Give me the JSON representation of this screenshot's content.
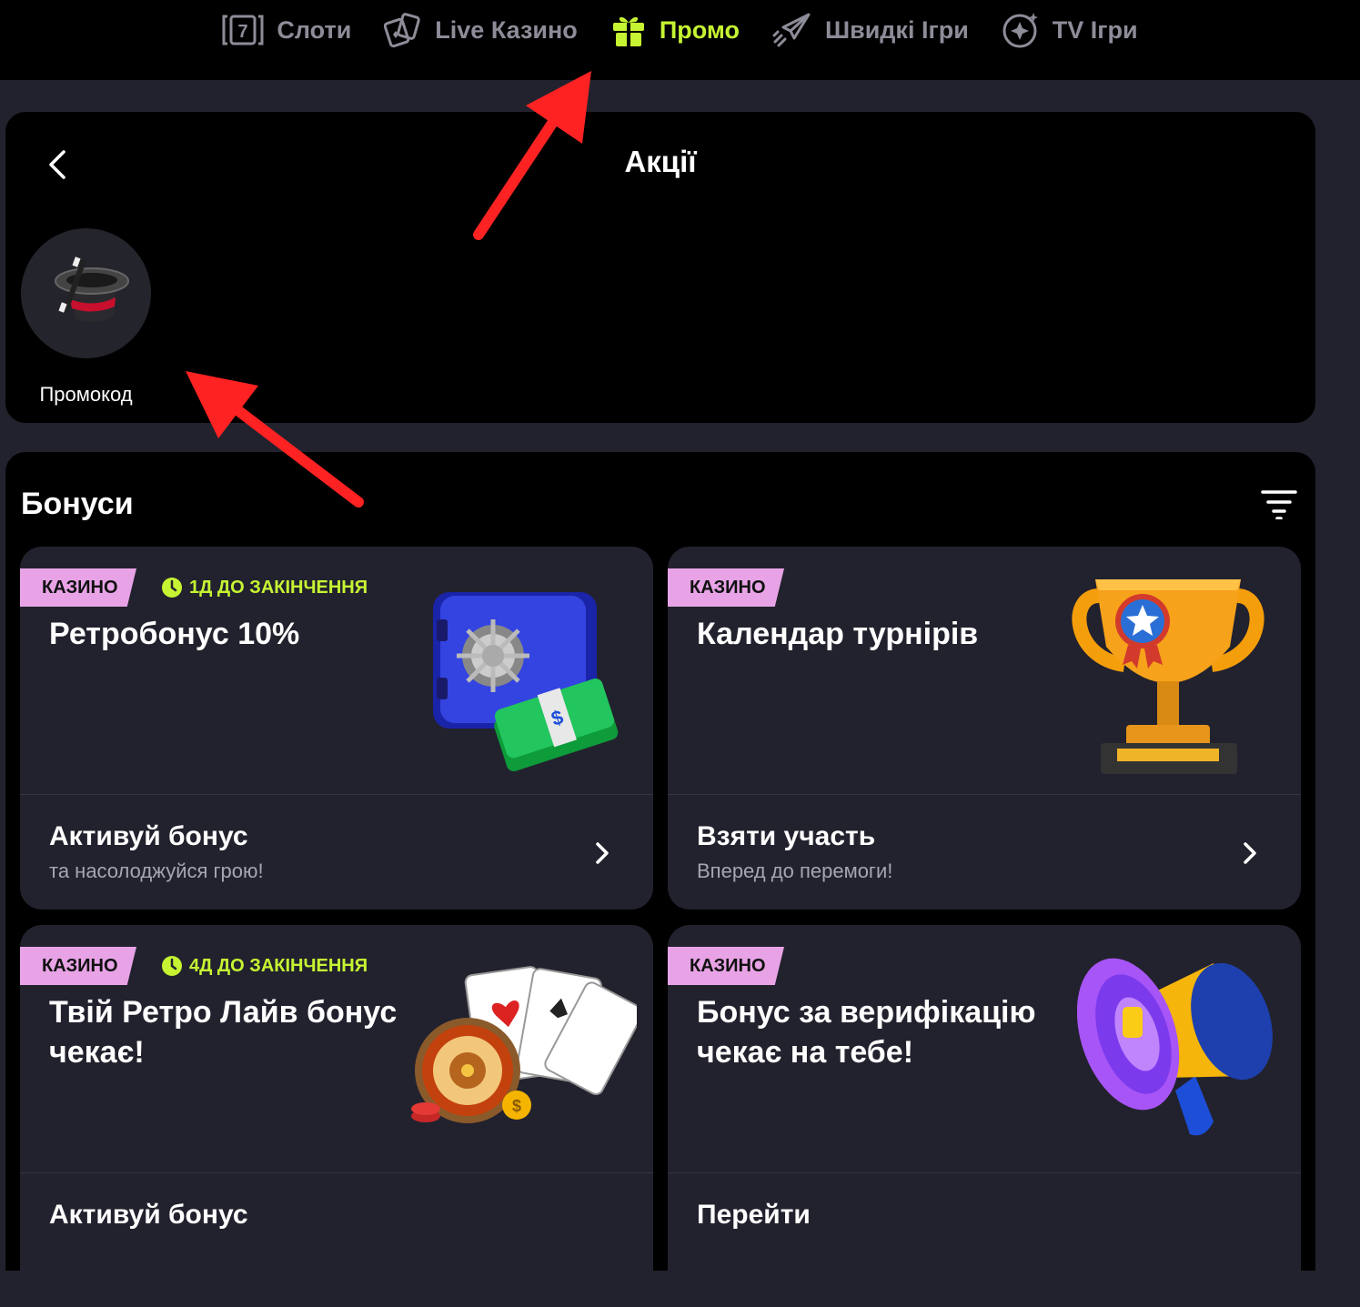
{
  "nav": {
    "items": [
      {
        "label": "Слоти",
        "icon": "slot-7-icon",
        "active": false
      },
      {
        "label": "Live Казино",
        "icon": "cards-icon",
        "active": false
      },
      {
        "label": "Промо",
        "icon": "gift-icon",
        "active": true
      },
      {
        "label": "Швидкі Ігри",
        "icon": "rocket-icon",
        "active": false
      },
      {
        "label": "TV Ігри",
        "icon": "tv-star-icon",
        "active": false
      }
    ],
    "active_color": "#c6f432"
  },
  "promotions": {
    "title": "Акції",
    "promo_code": {
      "label": "Промокод",
      "icon": "magic-hat-icon"
    }
  },
  "bonuses": {
    "title": "Бонуси",
    "cards": [
      {
        "tag": "КАЗИНО",
        "timer": "1Д ДО ЗАКІНЧЕННЯ",
        "title": "Ретробонус 10%",
        "action": "Активуй бонус",
        "subtitle": "та насолоджуйся грою!",
        "art": "safe-money-icon"
      },
      {
        "tag": "КАЗИНО",
        "timer": "",
        "title": "Календар турнірів",
        "action": "Взяти участь",
        "subtitle": "Вперед до перемоги!",
        "art": "trophy-icon"
      },
      {
        "tag": "КАЗИНО",
        "timer": "4Д ДО ЗАКІНЧЕННЯ",
        "title": "Твій Ретро Лайв бонус чекає!",
        "action": "Активуй бонус",
        "subtitle": "",
        "art": "roulette-cards-icon"
      },
      {
        "tag": "КАЗИНО",
        "timer": "",
        "title": "Бонус за верифікацію чекає на тебе!",
        "action": "Перейти",
        "subtitle": "",
        "art": "megaphone-icon"
      }
    ],
    "tag_color": "#e8a3e6"
  }
}
